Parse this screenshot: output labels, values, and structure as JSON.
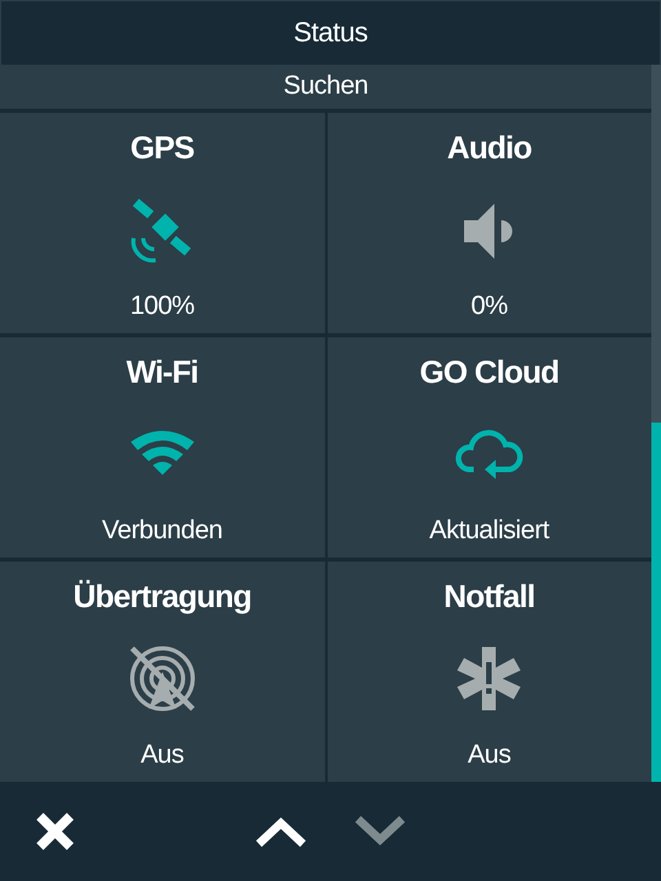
{
  "header": {
    "title": "Status"
  },
  "subheader": {
    "title": "Suchen"
  },
  "tiles": [
    {
      "kind": "gps",
      "title": "GPS",
      "value": "100%",
      "active": true
    },
    {
      "kind": "audio",
      "title": "Audio",
      "value": "0%",
      "active": false
    },
    {
      "kind": "wifi",
      "title": "Wi-Fi",
      "value": "Verbunden",
      "active": true
    },
    {
      "kind": "cloud",
      "title": "GO Cloud",
      "value": "Aktualisiert",
      "active": true
    },
    {
      "kind": "broadcast",
      "title": "Übertragung",
      "value": "Aus",
      "active": false
    },
    {
      "kind": "emergency",
      "title": "Notfall",
      "value": "Aus",
      "active": false
    }
  ],
  "footer": {
    "close": {
      "disabled": false
    },
    "up": {
      "disabled": false
    },
    "down": {
      "disabled": true
    }
  }
}
